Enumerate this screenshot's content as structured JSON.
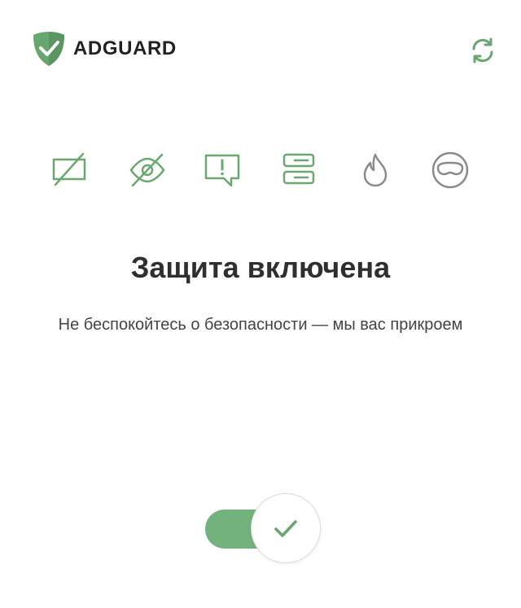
{
  "header": {
    "brand": "ADGUARD",
    "refresh_icon": "refresh-icon"
  },
  "features": [
    {
      "name": "ad-block-icon",
      "color": "#6aa870"
    },
    {
      "name": "tracking-block-icon",
      "color": "#6aa870"
    },
    {
      "name": "annoyance-block-icon",
      "color": "#6aa870"
    },
    {
      "name": "dns-filter-icon",
      "color": "#6aa870"
    },
    {
      "name": "phishing-protection-icon",
      "color": "#8a8a8a"
    },
    {
      "name": "stealth-mode-icon",
      "color": "#8a8a8a"
    }
  ],
  "status": {
    "title": "Защита включена",
    "subtitle": "Не беспокойтесь о безопасности — мы вас прикроем"
  },
  "toggle": {
    "state": "on",
    "icon": "check-icon"
  },
  "colors": {
    "accent": "#68a66f",
    "toggle_track": "#74b27d",
    "inactive": "#8a8a8a",
    "text": "#2f2f2f"
  }
}
